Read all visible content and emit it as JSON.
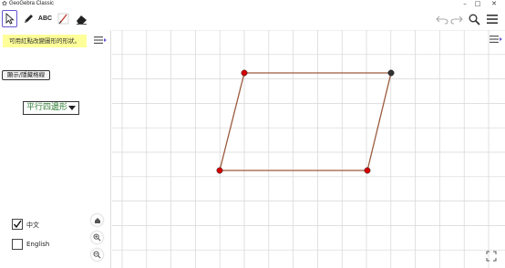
{
  "window": {
    "title": "GeoGebra Classic",
    "controls": [
      "–",
      "□",
      "✕"
    ]
  },
  "toolbar": {
    "tools": [
      {
        "name": "move",
        "icon": "arrow-cursor-icon",
        "selected": true
      },
      {
        "name": "pen",
        "icon": "pen-icon"
      },
      {
        "name": "text",
        "icon": "text-icon",
        "label": "ABC"
      },
      {
        "name": "freehand",
        "icon": "freehand-icon"
      },
      {
        "name": "eraser",
        "icon": "eraser-icon"
      }
    ],
    "right": [
      "undo-icon",
      "redo-icon",
      "search-icon",
      "menu-icon"
    ]
  },
  "panel": {
    "hint": "可用紅點改變圖形的形狀。",
    "toggle_grid_label": "顯示/隱藏格線",
    "shape_select_value": "平行四邊形",
    "checkboxes": [
      {
        "label": "中文",
        "checked": true
      },
      {
        "label": "English",
        "checked": false
      }
    ],
    "nav_icons": [
      "home-icon",
      "zoom-in-icon",
      "zoom-out-icon"
    ]
  },
  "graphics": {
    "shape": "parallelogram",
    "colors": {
      "grid": "#d6d6d6",
      "edge": "#9c5a3c",
      "point": "#d40000",
      "dependent_point": "#333333",
      "accent": "#6557d2",
      "hint_bg": "#ffff99",
      "select_text": "#2e7d32"
    }
  }
}
